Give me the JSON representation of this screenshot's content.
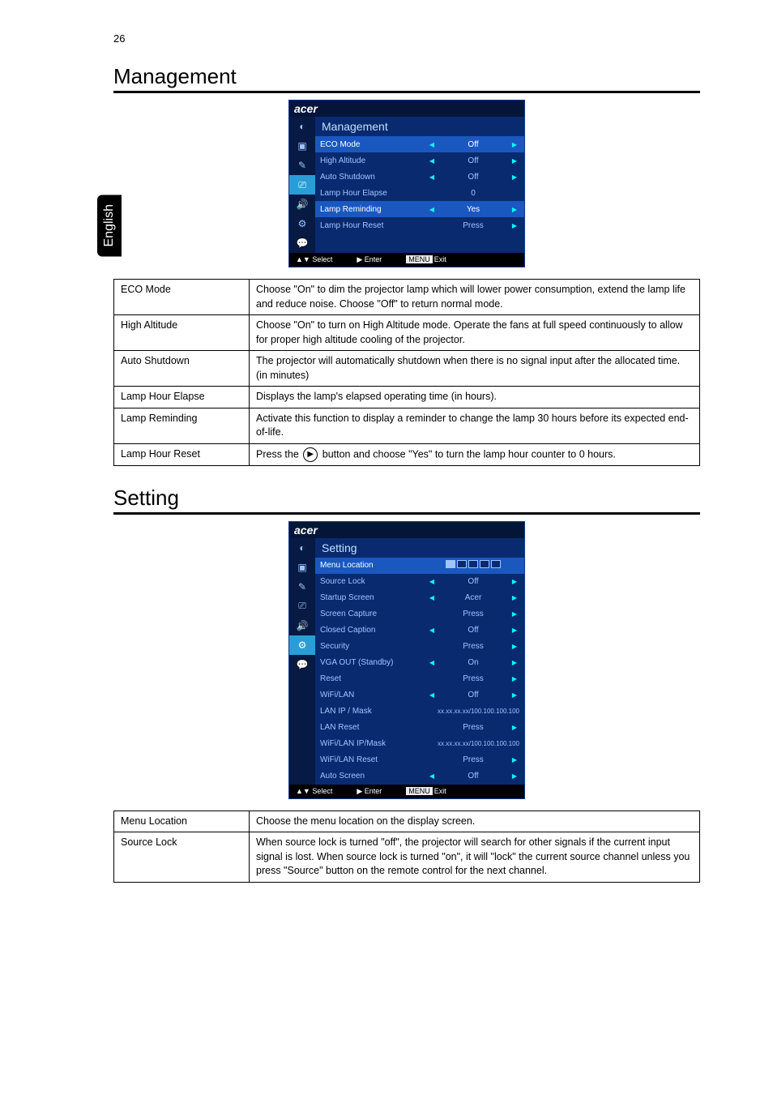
{
  "page_number": "26",
  "side_tab": "English",
  "brand": "acer",
  "management": {
    "heading": "Management",
    "menu_title": "Management",
    "footer": {
      "select": "▲▼ Select",
      "enter": "▶ Enter",
      "exit_key": "MENU",
      "exit": "Exit"
    },
    "rows": [
      {
        "label": "ECO Mode",
        "value": "Off"
      },
      {
        "label": "High Altitude",
        "value": "Off"
      },
      {
        "label": "Auto Shutdown",
        "value": "Off"
      },
      {
        "label": "Lamp Hour Elapse",
        "value": "0"
      },
      {
        "label": "Lamp Reminding",
        "value": "Yes"
      },
      {
        "label": "Lamp Hour Reset",
        "value": "Press"
      }
    ],
    "table": [
      {
        "name": "ECO Mode",
        "desc": "Choose \"On\" to dim the projector lamp which will lower power consumption, extend the lamp life and reduce noise. Choose \"Off\" to return normal mode."
      },
      {
        "name": "High Altitude",
        "desc": "Choose \"On\" to turn on High Altitude mode. Operate the fans at full speed continuously to allow for proper high altitude cooling of the projector."
      },
      {
        "name": "Auto Shutdown",
        "desc": "The projector will automatically shutdown when there is no signal input after the allocated time. (in minutes)"
      },
      {
        "name": "Lamp Hour Elapse",
        "desc": "Displays the lamp's elapsed operating time (in hours)."
      },
      {
        "name": "Lamp Reminding",
        "desc": "Activate this function to display a reminder to change the lamp 30 hours before its expected end-of-life."
      },
      {
        "name": "Lamp Hour Reset",
        "desc_before": "Press the ",
        "desc_after": " button and choose \"Yes\" to turn the lamp hour counter to 0 hours."
      }
    ]
  },
  "setting": {
    "heading": "Setting",
    "menu_title": "Setting",
    "footer": {
      "select": "▲▼ Select",
      "enter": "▶ Enter",
      "exit_key": "MENU",
      "exit": "Exit"
    },
    "rows": [
      {
        "label": "Menu Location",
        "value": "iconrow"
      },
      {
        "label": "Source Lock",
        "value": "Off"
      },
      {
        "label": "Startup Screen",
        "value": "Acer"
      },
      {
        "label": "Screen Capture",
        "value": "Press"
      },
      {
        "label": "Closed Caption",
        "value": "Off"
      },
      {
        "label": "Security",
        "value": "Press"
      },
      {
        "label": "VGA OUT (Standby)",
        "value": "On"
      },
      {
        "label": "Reset",
        "value": "Press"
      },
      {
        "label": "WiFi/LAN",
        "value": "Off"
      },
      {
        "label": "LAN IP / Mask",
        "value": "xx.xx.xx.xx/100.100.100.100"
      },
      {
        "label": "LAN Reset",
        "value": "Press"
      },
      {
        "label": "WiFi/LAN IP/Mask",
        "value": "xx.xx.xx.xx/100.100.100.100"
      },
      {
        "label": "WiFi/LAN Reset",
        "value": "Press"
      },
      {
        "label": "Auto Screen",
        "value": "Off"
      }
    ],
    "table": [
      {
        "name": "Menu Location",
        "desc": "Choose the menu location on the display screen."
      },
      {
        "name": "Source Lock",
        "desc": "When source lock is turned \"off\", the projector will search for other signals if the current input signal is lost. When source lock is turned \"on\", it will \"lock\" the current source channel unless you press \"Source\" button on the remote control for the next channel."
      }
    ]
  }
}
